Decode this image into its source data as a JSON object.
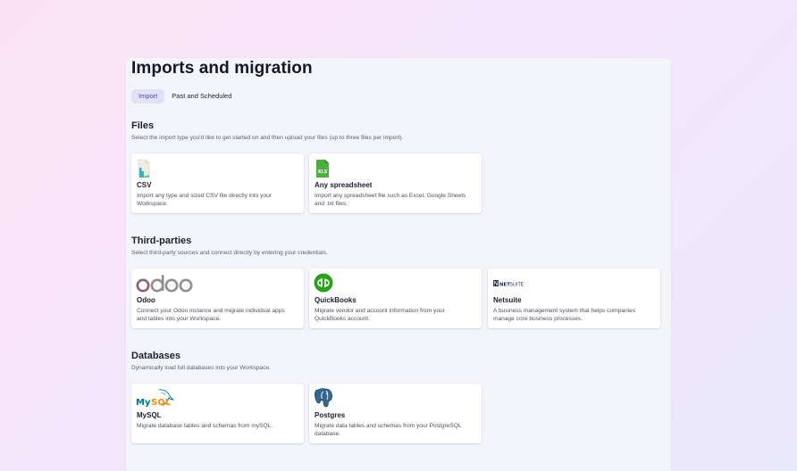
{
  "page": {
    "title": "Imports and migration"
  },
  "tabs": [
    {
      "label": "Import",
      "active": true
    },
    {
      "label": "Past and Scheduled",
      "active": false
    }
  ],
  "files": {
    "title": "Files",
    "description": "Select the import type you'd like to get started on and then upload your files (up to three files per import).",
    "cards": [
      {
        "icon": "csv-file-icon",
        "title": "CSV",
        "description": "Import any type and sized CSV file directly into your Workspace."
      },
      {
        "icon": "spreadsheet-xls-icon",
        "title": "Any spreadsheet",
        "description": "Import any spreadsheet file such as Excel, Google Sheets and .txt files."
      }
    ]
  },
  "third_parties": {
    "title": "Third-parties",
    "description": "Select third-party sources and connect directly by entering your credentials.",
    "cards": [
      {
        "icon": "odoo-logo",
        "logo_text": "odoo",
        "title": "Odoo",
        "description": "Connect your Odoo instance and migrate individual apps and tables into your Workspace."
      },
      {
        "icon": "quickbooks-logo",
        "logo_text": "qb",
        "title": "QuickBooks",
        "description": "Migrate vendor and account information from your QuickBooks account."
      },
      {
        "icon": "netsuite-logo",
        "logo_text": "NETSUITE",
        "title": "Netsuite",
        "description": "A business management system that helps companies manage core business processes."
      }
    ]
  },
  "databases": {
    "title": "Databases",
    "description": "Dynamically load full databases into your Workspace.",
    "cards": [
      {
        "icon": "mysql-logo",
        "logo_text": "MySQL",
        "title": "MySQL",
        "description": "Migrate database tables and schemas from mySQL."
      },
      {
        "icon": "postgres-elephant-logo",
        "title": "Postgres",
        "description": "Migrate data tables and schemas from your PostgreSQL database."
      }
    ]
  },
  "colors": {
    "active_tab_bg": "#e2e1f7",
    "odoo_purple": "#8f5c7e",
    "odoo_gray": "#8f8f8f",
    "quickbooks_green": "#2ca01c",
    "spreadsheet_green": "#4caf3f",
    "mysql_blue": "#00758f",
    "mysql_orange": "#f29111",
    "postgres_blue": "#336791"
  }
}
